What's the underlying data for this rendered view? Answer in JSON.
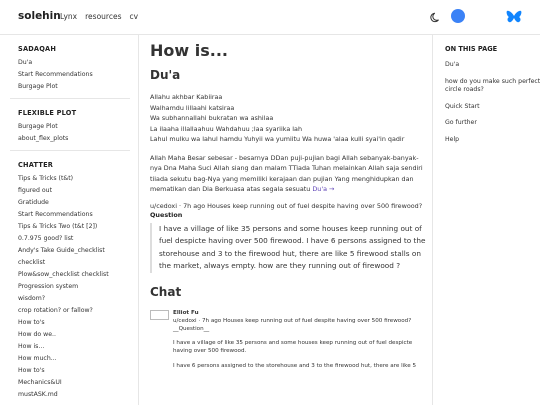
{
  "header": {
    "brand": "solehin",
    "nav": [
      "Lynx",
      "resources",
      "cv"
    ]
  },
  "sidebar": {
    "sections": [
      {
        "title": "SADAQAH",
        "items": [
          "Du'a",
          "Start Recommendations",
          "Burgage Plot"
        ]
      },
      {
        "title": "FLEXIBLE PLOT",
        "items": [
          "Burgage Plot",
          "about_flex_plots"
        ]
      },
      {
        "title": "CHATTER",
        "items": [
          "Tips & Tricks (t&t)",
          "figured out",
          "Gratidude",
          "Start Recommendations",
          "Tips & Tricks Two (t&t [2])",
          "0.7.975 good? list",
          "Andy's Take Guide_checklist",
          "checklist",
          "Plow&sow_checklist checklist",
          "Progression system",
          "wisdom?",
          "crop rotation? or fallow?",
          "How to's",
          "How do we..",
          "How is...",
          "How much...",
          "How to's",
          "Mechanics&UI",
          "mustASK.md"
        ]
      }
    ]
  },
  "main": {
    "title": "How is...",
    "section1": "Du'a",
    "poem": [
      "Allahu akhbar Kabiiraa",
      "Walhamdu lillaahi katsiraa",
      "Wa subhannallahi bukratan wa ashilaa",
      "La ilaaha illallaahuu Wahdahuu ;laa syariika lah",
      "Lahul mulku wa lahul hamdu Yuhyii wa yumiitu Wa huwa 'alaa kulli syai'in qadir"
    ],
    "paragraph": "Allah Maha Besar sebesar - besarnya DDan puji-pujian bagi Allah sebanyak-banyak-nya Dna Maha Suci Allah siang dan malam TTiada Tuhan melainkan Allah saja sendiri tiiada sekutu bag-Nya yang memiliki kerajaan dan pujian Yang menghidupkan dan mematikan dan Dia Berkuasa atas segala sesuatu",
    "paragraph_link": "Du'a →",
    "meta": "u/cedoxi · 7h ago Houses keep running out of fuel despite having over 500 firewood?",
    "question_label": "Question",
    "quote": "I have a village of like 35 persons and some houses keep running out of fuel despicte having over 500 firewood. I have 6 persons assigned to the storehouse and 3 to the firewood hut, there are like 5 firewood stalls on the market, always empty. how are they running out of firewood ?",
    "section2": "Chat",
    "chat": {
      "name": "Elliot Fu",
      "line": "u/cedoxi · 7h ago Houses keep running out of fuel despite having over 500 firewood? __Question__",
      "p1": "I have a village of like 35 persons and some houses keep running out of fuel despicte having over 500 firewood.",
      "p2": "I have 6 persons assigned to the storehouse and 3 to the firewood hut, there are like 5"
    }
  },
  "toc": {
    "title": "ON THIS PAGE",
    "items": [
      "Du'a",
      "how do you make such perfect circle roads?",
      "Quick Start",
      "Go further",
      "Help"
    ]
  },
  "colors": {
    "accent": "#5b3fb5",
    "avatar": "#3b82f6",
    "butterfly": "#1185fe"
  },
  "icons": {
    "theme": "moon-icon",
    "social": "butterfly-icon"
  }
}
